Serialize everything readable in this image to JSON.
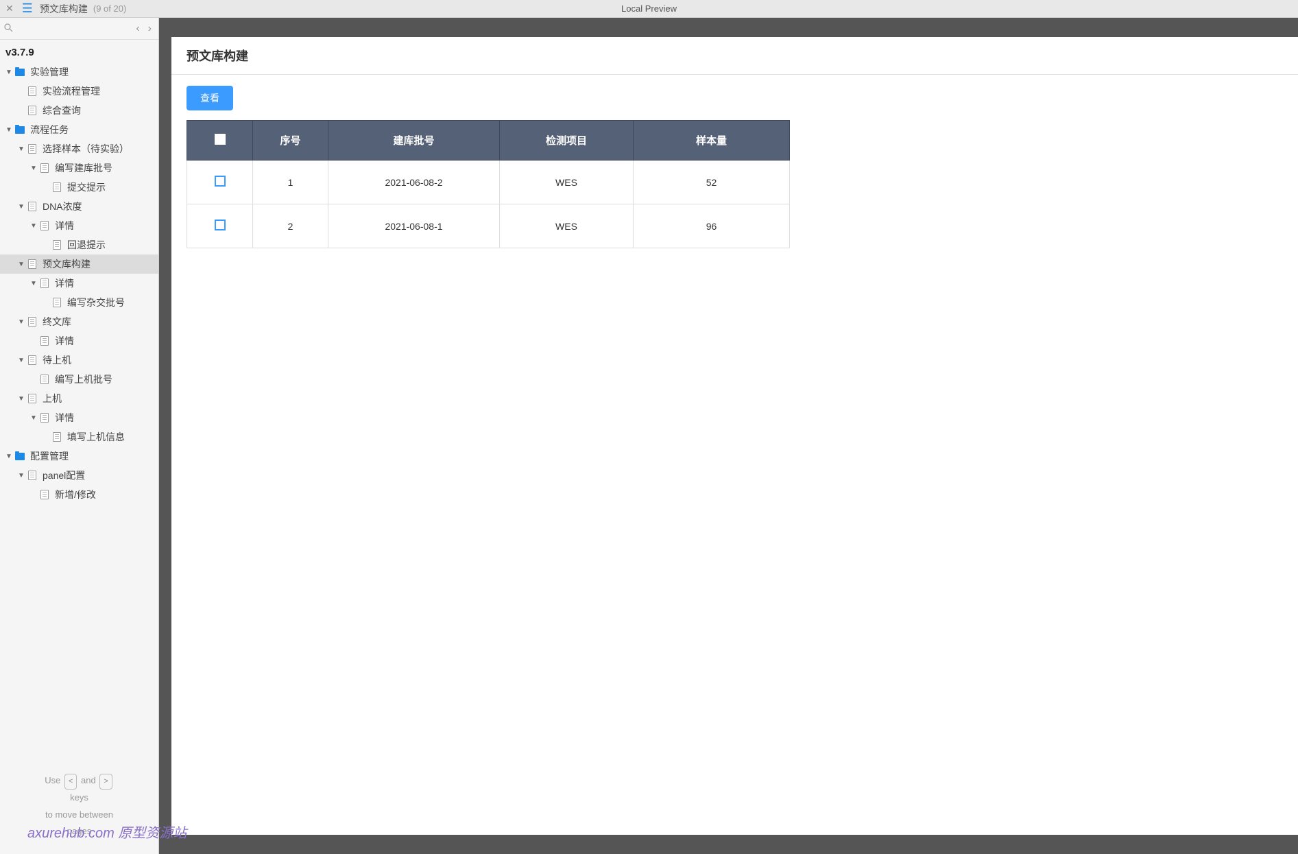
{
  "topbar": {
    "page_name": "预文库构建",
    "page_count": "(9 of 20)",
    "center_label": "Local Preview"
  },
  "sidebar": {
    "version": "v3.7.9",
    "hint": {
      "use": "Use",
      "and": "and",
      "line2": "to move between",
      "line3": "keys",
      "line4": "pages",
      "key_left": "<",
      "key_right": ">"
    }
  },
  "tree": {
    "n0": "实验管理",
    "n1": "实验流程管理",
    "n2": "综合查询",
    "n3": "流程任务",
    "n4": "选择样本（待实验）",
    "n5": "编写建库批号",
    "n6": "提交提示",
    "n7": "DNA浓度",
    "n8": "详情",
    "n9": "回退提示",
    "n10": "预文库构建",
    "n11": "详情",
    "n12": "编写杂交批号",
    "n13": "终文库",
    "n14": "详情",
    "n15": "待上机",
    "n16": "编写上机批号",
    "n17": "上机",
    "n18": "详情",
    "n19": "填写上机信息",
    "n20": "配置管理",
    "n21": "panel配置",
    "n22": "新增/修改"
  },
  "panel": {
    "title": "预文库构建",
    "view_btn": "查看"
  },
  "table": {
    "headers": {
      "h1": "序号",
      "h2": "建库批号",
      "h3": "检测项目",
      "h4": "样本量"
    },
    "r0": {
      "c1": "1",
      "c2": "2021-06-08-2",
      "c3": "WES",
      "c4": "52"
    },
    "r1": {
      "c1": "2",
      "c2": "2021-06-08-1",
      "c3": "WES",
      "c4": "96"
    }
  },
  "watermark": "axurehub.com 原型资源站"
}
